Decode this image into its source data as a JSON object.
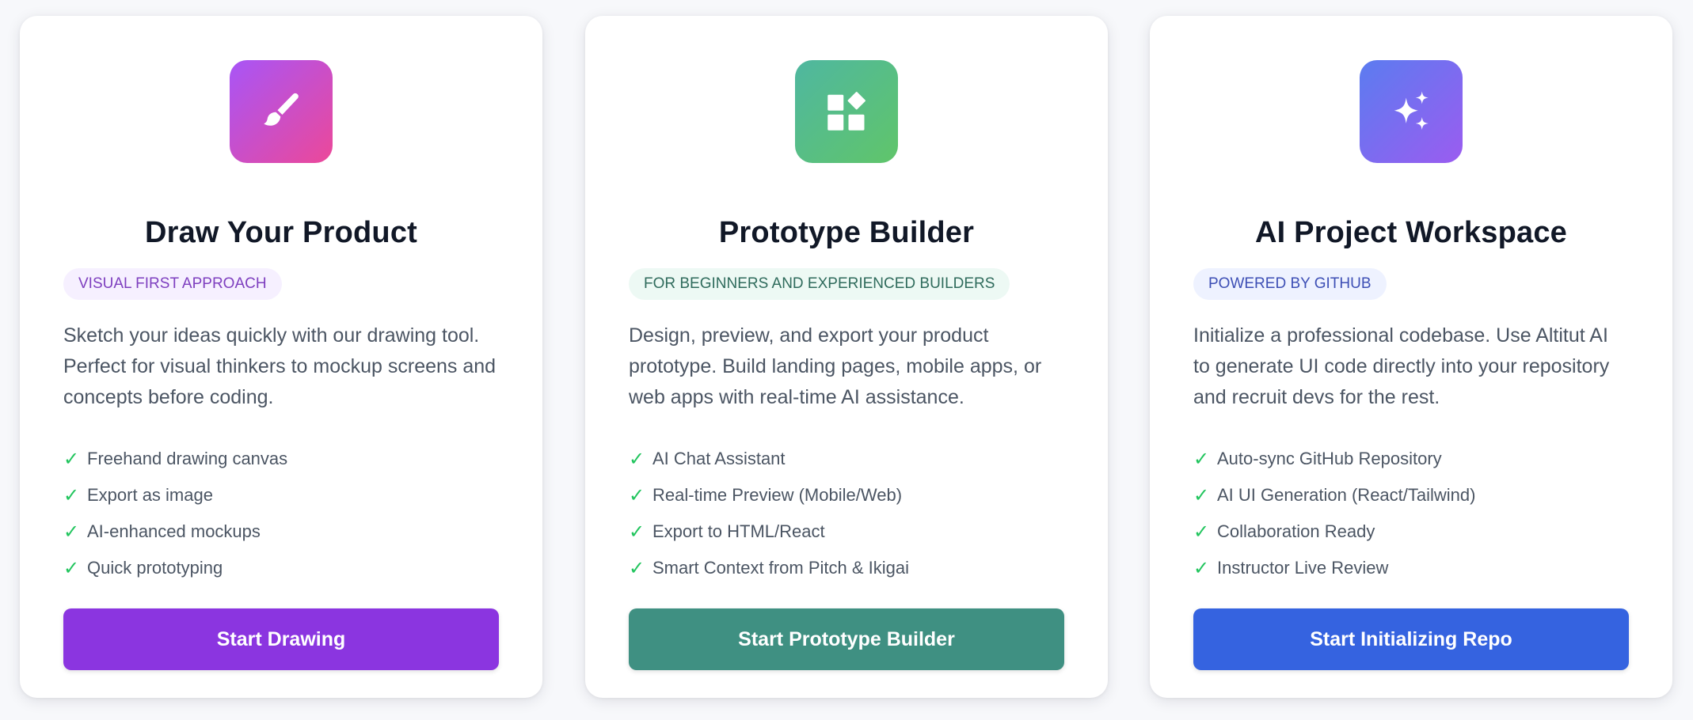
{
  "cards": [
    {
      "icon": "paintbrush-icon",
      "title": "Draw Your Product",
      "badge": "VISUAL FIRST APPROACH",
      "description": "Sketch your ideas quickly with our drawing tool. Perfect for visual thinkers to mockup screens and concepts before coding.",
      "check": "✓",
      "features": [
        "Freehand drawing canvas",
        "Export as image",
        "AI-enhanced mockups",
        "Quick prototyping"
      ],
      "button": "Start Drawing",
      "accent": "#8b35e0"
    },
    {
      "icon": "shapes-icon",
      "title": "Prototype Builder",
      "badge": "FOR BEGINNERS AND EXPERIENCED BUILDERS",
      "description": "Design, preview, and export your product prototype. Build landing pages, mobile apps, or web apps with real-time AI assistance.",
      "check": "✓",
      "features": [
        "AI Chat Assistant",
        "Real-time Preview (Mobile/Web)",
        "Export to HTML/React",
        "Smart Context from Pitch & Ikigai"
      ],
      "button": "Start Prototype Builder",
      "accent": "#3f9082"
    },
    {
      "icon": "sparkles-icon",
      "title": "AI Project Workspace",
      "badge": "POWERED BY GITHUB",
      "description": "Initialize a professional codebase. Use Altitut AI to generate UI code directly into your repository and recruit devs for the rest.",
      "check": "✓",
      "features": [
        "Auto-sync GitHub Repository",
        "AI UI Generation (React/Tailwind)",
        "Collaboration Ready",
        "Instructor Live Review"
      ],
      "button": "Start Initializing Repo",
      "accent": "#3563e0"
    }
  ]
}
